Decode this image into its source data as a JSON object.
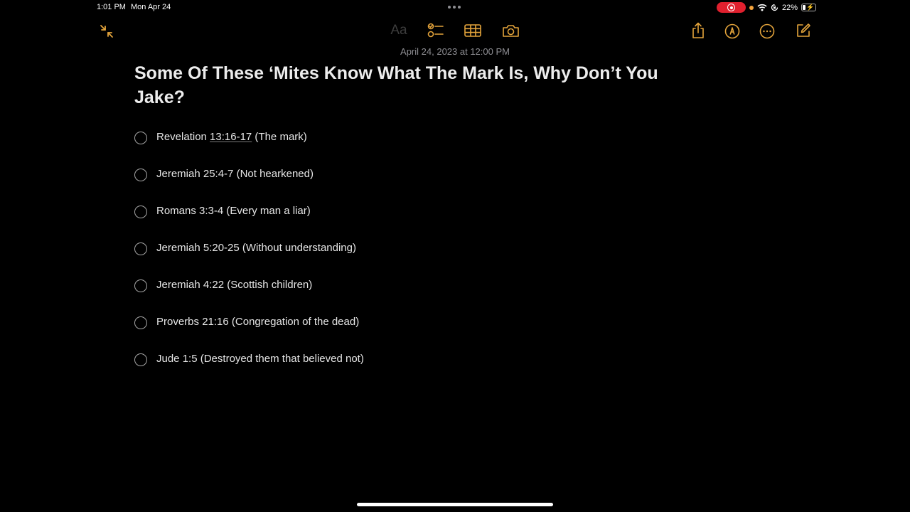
{
  "status_bar": {
    "time": "1:01 PM",
    "date": "Mon Apr 24",
    "battery_percent": "22%",
    "battery_level": 0.22,
    "icons": [
      "screen-record-icon",
      "wifi-icon",
      "orientation-lock-icon",
      "battery-icon"
    ]
  },
  "toolbar": {
    "left": [
      "collapse-icon"
    ],
    "center": {
      "format_label": "Aa",
      "icons": [
        "checklist-icon",
        "table-icon",
        "camera-icon"
      ]
    },
    "right": [
      "share-icon",
      "markup-pen-icon",
      "more-icon",
      "compose-icon"
    ],
    "accent_color": "#e4a43b"
  },
  "note": {
    "date": "April 24, 2023 at 12:00 PM",
    "title": "Some Of These ‘Mites Know What The Mark Is, Why Don’t You Jake?",
    "checklist": [
      {
        "book": "Revelation ",
        "ref": "13:16-17",
        "note": " (The mark)",
        "checked": false
      },
      {
        "book": "Jeremiah ",
        "ref": "25:4-7",
        "note": " (Not hearkened)",
        "checked": false
      },
      {
        "book": "Romans ",
        "ref": "3:3-4",
        "note": " (Every man a liar)",
        "checked": false
      },
      {
        "book": "Jeremiah ",
        "ref": "5:20-25",
        "note": " (Without understanding)",
        "checked": false
      },
      {
        "book": "Jeremiah ",
        "ref": "4:22",
        "note": " (Scottish children)",
        "checked": false
      },
      {
        "book": "Proverbs ",
        "ref": "21:16",
        "note": " (Congregation of the dead)",
        "checked": false
      },
      {
        "book": "Jude ",
        "ref": "1:5",
        "note": " (Destroyed them that believed not)",
        "checked": false
      }
    ]
  }
}
